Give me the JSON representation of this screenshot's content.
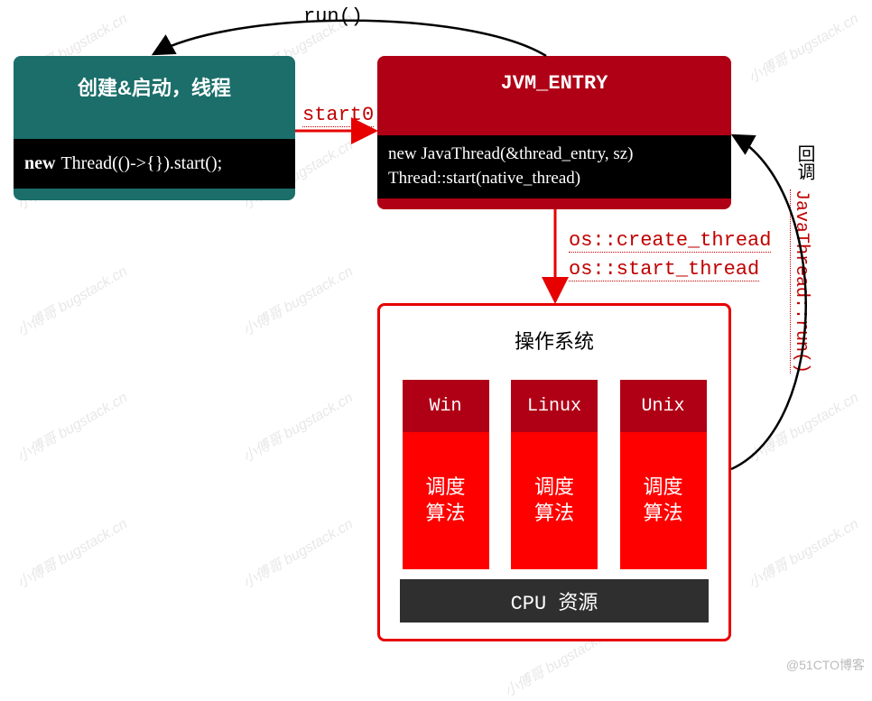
{
  "watermark": "小傅哥 bugstack.cn",
  "java_box": {
    "title": "创建&启动，线程",
    "kw": "new",
    "code": "Thread(()->{}).start();"
  },
  "jvm_box": {
    "title": "JVM_ENTRY",
    "line1": "new JavaThread(&thread_entry, sz)",
    "line2": "Thread::start(native_thread)"
  },
  "labels": {
    "start0": "start0",
    "run": "run()",
    "create": "os::create_thread",
    "start": "os::start_thread",
    "callback": "回调",
    "jt_run": "JavaThread::run()"
  },
  "os_box": {
    "title": "操作系统",
    "cols": [
      {
        "name": "Win",
        "sched": "调度\n算法"
      },
      {
        "name": "Linux",
        "sched": "调度\n算法"
      },
      {
        "name": "Unix",
        "sched": "调度\n算法"
      }
    ],
    "cpu": "CPU 资源"
  },
  "footer": "@51CTO博客"
}
